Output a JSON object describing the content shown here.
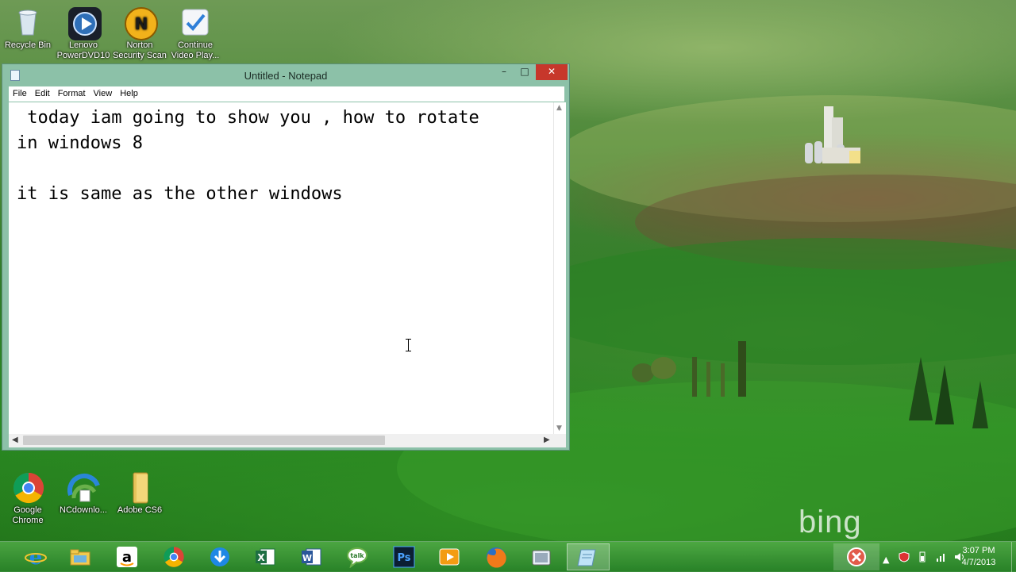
{
  "desktop_icons": [
    {
      "label": "Recycle Bin",
      "icon": "recycle-bin-icon"
    },
    {
      "label": "Lenovo PowerDVD10",
      "icon": "powerdvd-icon"
    },
    {
      "label": "Norton Security Scan",
      "icon": "norton-icon"
    },
    {
      "label": "Continue Video Play...",
      "icon": "continue-video-icon"
    },
    {
      "label": "Google Chrome",
      "icon": "chrome-icon"
    },
    {
      "label": "NCdownlo...",
      "icon": "ncdownloader-icon"
    },
    {
      "label": "Adobe CS6",
      "icon": "folder-icon"
    }
  ],
  "watermark": "bing",
  "notepad": {
    "title": "Untitled - Notepad",
    "controls": {
      "minimize": "–",
      "maximize": "□",
      "close": "✕"
    },
    "menu": [
      "File",
      "Edit",
      "Format",
      "View",
      "Help"
    ],
    "content": " today iam going to show you , how to rotate\nin windows 8\n\nit is same as the other windows"
  },
  "taskbar": {
    "apps": [
      {
        "name": "internet-explorer",
        "icon": "ie-icon",
        "active": false
      },
      {
        "name": "file-explorer",
        "icon": "folder-icon",
        "active": false
      },
      {
        "name": "amazon",
        "icon": "amazon-icon",
        "active": false
      },
      {
        "name": "chrome",
        "icon": "chrome-icon",
        "active": false
      },
      {
        "name": "downloader",
        "icon": "download-arrow-icon",
        "active": false
      },
      {
        "name": "excel",
        "icon": "excel-icon",
        "active": false
      },
      {
        "name": "word",
        "icon": "word-icon",
        "active": false
      },
      {
        "name": "google-talk",
        "icon": "talk-icon",
        "active": false
      },
      {
        "name": "photoshop",
        "icon": "photoshop-icon",
        "active": false
      },
      {
        "name": "media-player",
        "icon": "media-player-icon",
        "active": false
      },
      {
        "name": "firefox",
        "icon": "firefox-icon",
        "active": false
      },
      {
        "name": "snipping-tool",
        "icon": "camera-icon",
        "active": false
      },
      {
        "name": "notepad",
        "icon": "notepad-icon",
        "active": true
      }
    ],
    "tray": {
      "chevron": "▲"
    },
    "clock": {
      "time": "3:07 PM",
      "date": "4/7/2013"
    }
  },
  "colors": {
    "window_frame": "#8cc1a8",
    "close_button": "#c7372b",
    "taskbar": "#3f9a3a"
  }
}
